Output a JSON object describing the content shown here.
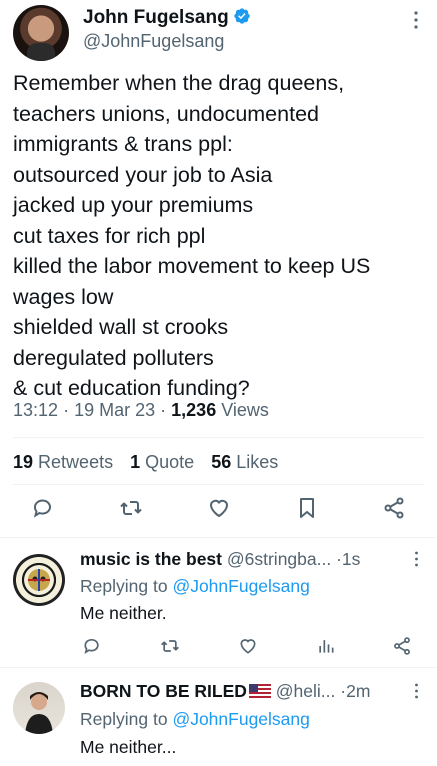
{
  "main_tweet": {
    "author_name": "John Fugelsang",
    "author_handle": "@JohnFugelsang",
    "lines": [
      "Remember when the drag queens,",
      "teachers unions, undocumented",
      "immigrants & trans ppl:",
      "outsourced your job to Asia",
      "jacked up your premiums",
      "cut taxes for rich ppl",
      "killed the labor movement to keep US",
      "wages low",
      "shielded wall st crooks",
      "deregulated polluters",
      "& cut education funding?"
    ],
    "time": "13:12",
    "date": "19 Mar 23",
    "views_count": "1,236",
    "views_label": "Views",
    "retweets_count": "19",
    "retweets_label": "Retweets",
    "quotes_count": "1",
    "quotes_label": "Quote",
    "likes_count": "56",
    "likes_label": "Likes"
  },
  "replies": [
    {
      "name": "music is the best",
      "handle": "@6stringba...",
      "time": "1s",
      "replying_prefix": "Replying to",
      "replying_to": "@JohnFugelsang",
      "text": "Me neither."
    },
    {
      "name": "BORN TO BE RILED",
      "handle": "@heli...",
      "time": "2m",
      "replying_prefix": "Replying to",
      "replying_to": "@JohnFugelsang",
      "text": "Me neither..."
    }
  ],
  "colors": {
    "text": "#0f1419",
    "secondary": "#536471",
    "accent": "#1d9bf0",
    "divider": "#eff3f4"
  }
}
